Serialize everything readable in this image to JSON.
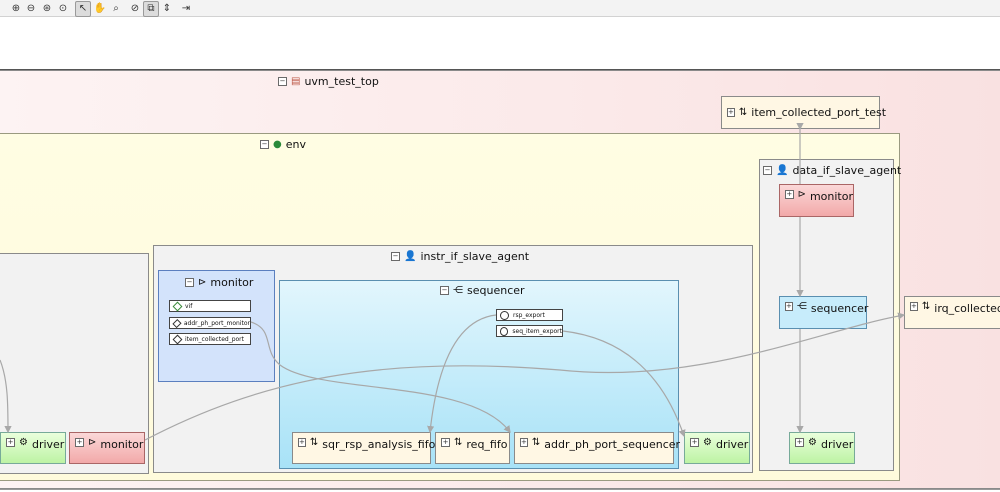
{
  "toolbar": {
    "icons": [
      "zoom-in-icon",
      "zoom-out-icon",
      "zoom-fit-icon",
      "zoom-region-icon",
      "select-pointer-icon",
      "pan-hand-icon",
      "magnifier-icon",
      "zoom-reset-icon",
      "layout-icon",
      "expand-icon",
      "export-icon"
    ],
    "active": [
      "select-pointer-icon",
      "layout-icon"
    ]
  },
  "tree": {
    "top": {
      "label": "uvm_test_top"
    },
    "item_collected_port_test": {
      "label": "item_collected_port_test"
    },
    "env": {
      "label": "env"
    },
    "data_if_slave_agent": {
      "label": "data_if_slave_agent",
      "monitor": "monitor",
      "sequencer": "sequencer",
      "driver": "driver"
    },
    "irq_collected": {
      "label": "irq_collected_"
    },
    "left_agent": {
      "driver": "driver",
      "monitor": "monitor"
    },
    "instr_if_slave_agent": {
      "label": "instr_if_slave_agent",
      "monitor": {
        "label": "monitor",
        "ports": [
          "vif",
          "addr_ph_port_monitor",
          "item_collected_port"
        ]
      },
      "sequencer": {
        "label": "sequencer",
        "ports": [
          "rsp_export",
          "seq_item_export"
        ],
        "children": [
          "sqr_rsp_analysis_fifo",
          "req_fifo",
          "addr_ph_port_sequencer"
        ]
      },
      "driver": "driver"
    }
  },
  "colors": {
    "uvm_test_top_bg": "#fbe9e9",
    "env_bg": "#fffbdc",
    "agent_bg": "#f2f2f2",
    "monitor_box_bg": "#d3e3fb",
    "sequencer_bg": "#a8e2f7",
    "leaf_monitor": "#f2a9a9",
    "leaf_driver": "#bdf3a4",
    "leaf_port": "#fff7e4",
    "wire": "#a8a8a8"
  }
}
